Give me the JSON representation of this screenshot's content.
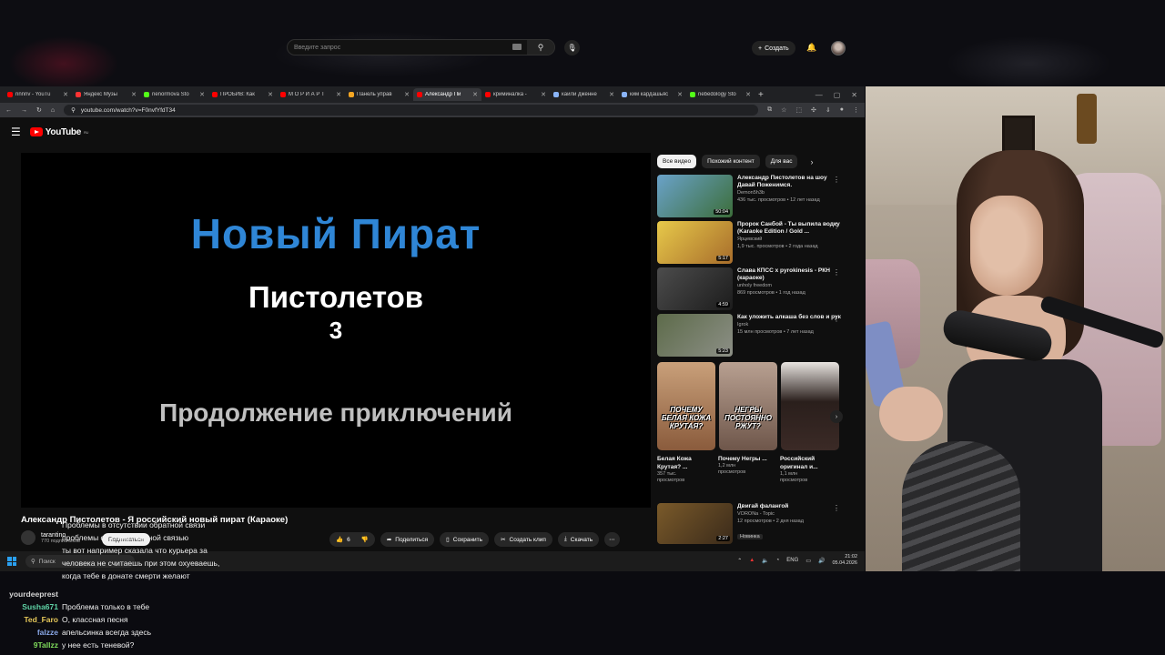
{
  "browser": {
    "tabs": [
      {
        "label": "nnnnv - YouTu",
        "color": "#ff0000"
      },
      {
        "label": "Яндекс Музы",
        "color": "#ff3333"
      },
      {
        "label": "nenormova Sto",
        "color": "#53fc18"
      },
      {
        "label": "ПРОБИВ: Как",
        "color": "#ff0000"
      },
      {
        "label": "М О Р И А Р Т",
        "color": "#ff0000"
      },
      {
        "label": "Панель управ",
        "color": "#f5a623"
      },
      {
        "label": "Александр Пи",
        "color": "#ff0000",
        "active": true
      },
      {
        "label": "криминалка -",
        "color": "#ff0000"
      },
      {
        "label": "кайли дженне",
        "color": "#8ab4f8"
      },
      {
        "label": "ким кардашьяс",
        "color": "#8ab4f8"
      },
      {
        "label": "nebedology Sto",
        "color": "#53fc18"
      }
    ],
    "url": "youtube.com/watch?v=F0nvfYfdT34"
  },
  "youtube": {
    "logo": "YouTube",
    "logo_region": "RU",
    "search_placeholder": "Введите запрос",
    "create_label": "Создать",
    "player": {
      "title": "Новый Пират",
      "subtitle": "Пистолетов",
      "number": "3",
      "continuation": "Продолжение приключений"
    },
    "video_title": "Александр Пистолетов - Я российский новый пират (Караоке)",
    "channel": "tarantino",
    "subscribers": "770 подписчиков",
    "subscribe_label": "Подписаться",
    "likes": "6",
    "actions": {
      "share": "Поделиться",
      "save": "Сохранить",
      "clip": "Создать клип",
      "download": "Скачать"
    },
    "chips": [
      "Все видео",
      "Похожий контент",
      "Для вас"
    ],
    "recommendations": [
      {
        "title": "Александр Пистолетов на шоу Давай Поженимся.",
        "channel": "Demon5h3b",
        "meta": "436 тыс. просмотров • 12 лет назад",
        "duration": "50:04"
      },
      {
        "title": "Пророк Санбой - Ты выпила водку (Karaoke Edition / Gold ...",
        "channel": "Ярцевский",
        "meta": "1,9 тыс. просмотров • 2 года назад",
        "duration": "5:17"
      },
      {
        "title": "Слава КПСС x pyrokinesis - РКН (караоке)",
        "channel": "unholy freedom",
        "meta": "869 просмотров • 1 год назад",
        "duration": "4:59"
      },
      {
        "title": "Как уложить алкаша без слов и рук",
        "channel": "Igrok",
        "meta": "15 млн просмотров • 7 лет назад",
        "duration": "5:23"
      }
    ],
    "shorts": [
      {
        "overlay": "ПОЧЕМУ БЕЛАЯ КОЖА КРУТАЯ?",
        "title": "Белая Кожа Крутая? ...",
        "views": "357 тыс.",
        "views2": "просмотров"
      },
      {
        "overlay": "НЕГРЫ ПОСТОЯННО РЖУТ?",
        "title": "Почему Негры ...",
        "views": "1,2 млн",
        "views2": "просмотров"
      },
      {
        "overlay": "",
        "title": "Российский оригинал и...",
        "views": "1,1 млн",
        "views2": "просмотров"
      }
    ],
    "last_rec": {
      "title": "Двигай фалангой",
      "channel": "VORONa - Topic",
      "meta": "12 просмотров • 2 дня назад",
      "badge": "Новинка",
      "duration": "2:27"
    }
  },
  "taskbar": {
    "search": "Поиск",
    "lang": "ENG",
    "time": "21:02",
    "date": "05.04.2026"
  },
  "chat": [
    {
      "user": "",
      "message": "Проблемы в отсутствии обратной связи",
      "color": "#ffffff"
    },
    {
      "user": "",
      "message": "проблемы со следственной связью",
      "color": "#ffffff"
    },
    {
      "user": "",
      "message": "ты вот например сказала что курьера за",
      "color": "#ffffff"
    },
    {
      "user": "",
      "message": "человека не считаешь при этом охуеваешь,",
      "color": "#ffffff"
    },
    {
      "user": "",
      "message": "когда тебе в донате смерти желают",
      "color": "#ffffff"
    },
    {
      "user": "yourdeeprest",
      "message": "",
      "color": "#d4d4d4"
    },
    {
      "user": "Susha671",
      "message": "Проблема только в тебе",
      "color": "#5fd3a6"
    },
    {
      "user": "Ted_Faro",
      "message": "О, классная песня",
      "color": "#e6c85a"
    },
    {
      "user": "falzze",
      "message": "апельсинка всегда здесь",
      "color": "#8aa8e8"
    },
    {
      "user": "9Tallzz",
      "message": "у нее есть теневой?",
      "color": "#7fdc5c"
    }
  ]
}
